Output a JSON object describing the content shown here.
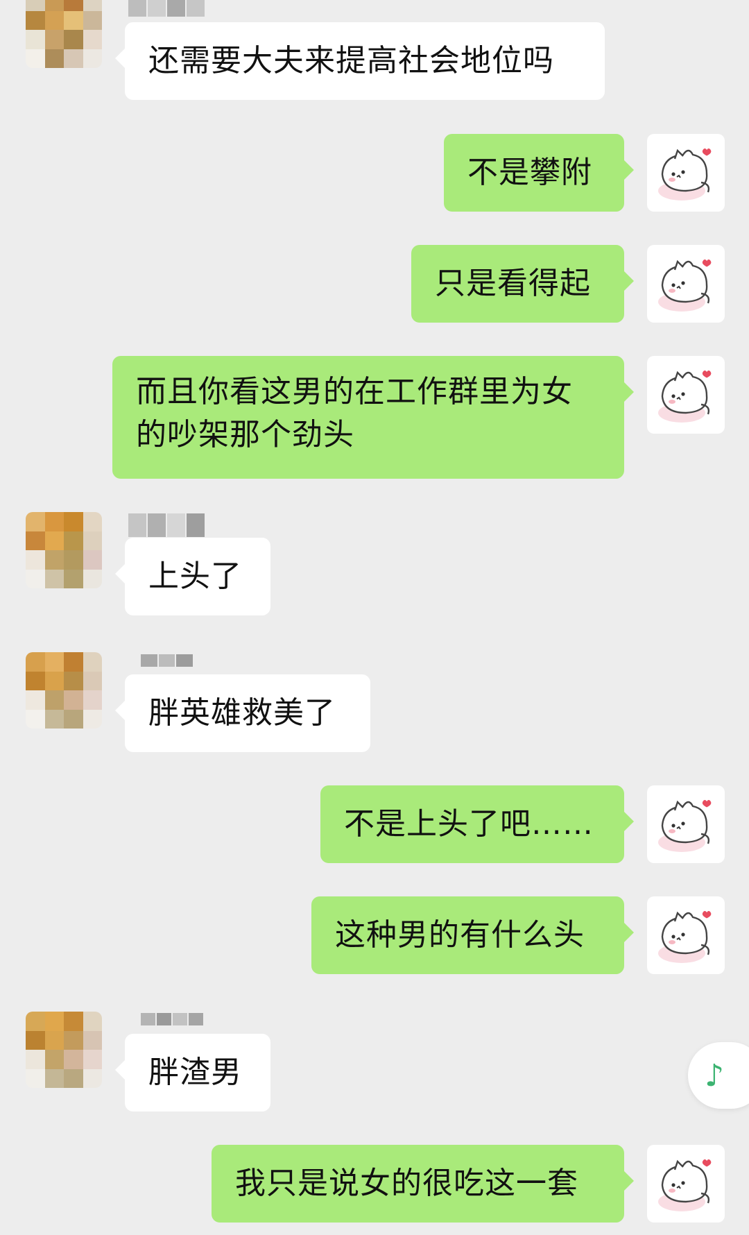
{
  "messages": [
    {
      "from": "other",
      "text": "还需要大夫来提高社会地位吗"
    },
    {
      "from": "self",
      "text": "不是攀附"
    },
    {
      "from": "self",
      "text": "只是看得起"
    },
    {
      "from": "self",
      "text": "而且你看这男的在工作群里为女的吵架那个劲头"
    },
    {
      "from": "other",
      "text": "上头了"
    },
    {
      "from": "other",
      "text": "胖英雄救美了"
    },
    {
      "from": "self",
      "text": "不是上头了吧……"
    },
    {
      "from": "self",
      "text": "这种男的有什么头"
    },
    {
      "from": "other",
      "text": "胖渣男"
    },
    {
      "from": "self",
      "text": "我只是说女的很吃这一套"
    }
  ],
  "icons": {
    "self_avatar": "white-cat-sticker-avatar-icon",
    "other_avatar": "pixelated-avatar",
    "floating_button": "music-note-icon"
  },
  "floating_button": {
    "glyph": "♪"
  },
  "colors": {
    "background": "#ededed",
    "incoming_bubble": "#ffffff",
    "outgoing_bubble": "#a9ea7a",
    "music_icon": "#3cb371"
  }
}
